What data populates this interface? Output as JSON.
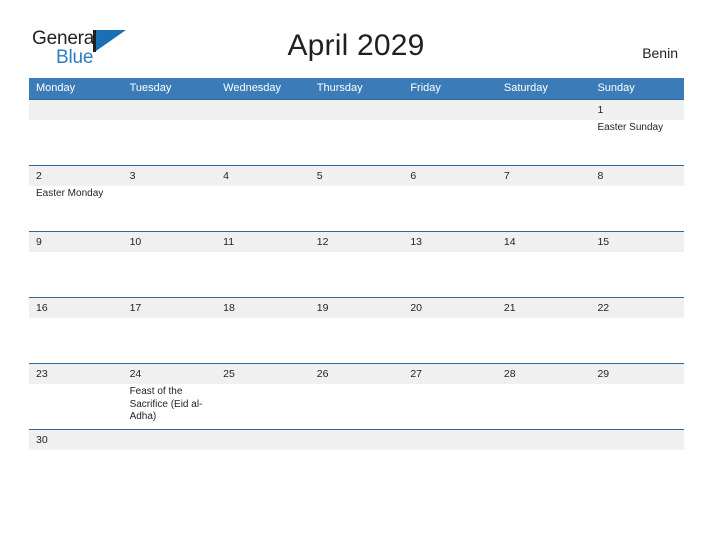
{
  "brand": {
    "word_one": "General",
    "word_two": "Blue"
  },
  "header": {
    "title": "April 2029",
    "locale": "Benin"
  },
  "calendar": {
    "weekdays": [
      "Monday",
      "Tuesday",
      "Wednesday",
      "Thursday",
      "Friday",
      "Saturday",
      "Sunday"
    ],
    "weeks": [
      [
        {
          "day": "",
          "event": ""
        },
        {
          "day": "",
          "event": ""
        },
        {
          "day": "",
          "event": ""
        },
        {
          "day": "",
          "event": ""
        },
        {
          "day": "",
          "event": ""
        },
        {
          "day": "",
          "event": ""
        },
        {
          "day": "1",
          "event": "Easter Sunday"
        }
      ],
      [
        {
          "day": "2",
          "event": "Easter Monday"
        },
        {
          "day": "3",
          "event": ""
        },
        {
          "day": "4",
          "event": ""
        },
        {
          "day": "5",
          "event": ""
        },
        {
          "day": "6",
          "event": ""
        },
        {
          "day": "7",
          "event": ""
        },
        {
          "day": "8",
          "event": ""
        }
      ],
      [
        {
          "day": "9",
          "event": ""
        },
        {
          "day": "10",
          "event": ""
        },
        {
          "day": "11",
          "event": ""
        },
        {
          "day": "12",
          "event": ""
        },
        {
          "day": "13",
          "event": ""
        },
        {
          "day": "14",
          "event": ""
        },
        {
          "day": "15",
          "event": ""
        }
      ],
      [
        {
          "day": "16",
          "event": ""
        },
        {
          "day": "17",
          "event": ""
        },
        {
          "day": "18",
          "event": ""
        },
        {
          "day": "19",
          "event": ""
        },
        {
          "day": "20",
          "event": ""
        },
        {
          "day": "21",
          "event": ""
        },
        {
          "day": "22",
          "event": ""
        }
      ],
      [
        {
          "day": "23",
          "event": ""
        },
        {
          "day": "24",
          "event": "Feast of the Sacrifice (Eid al-Adha)"
        },
        {
          "day": "25",
          "event": ""
        },
        {
          "day": "26",
          "event": ""
        },
        {
          "day": "27",
          "event": ""
        },
        {
          "day": "28",
          "event": ""
        },
        {
          "day": "29",
          "event": ""
        }
      ],
      [
        {
          "day": "30",
          "event": ""
        },
        {
          "day": "",
          "event": ""
        },
        {
          "day": "",
          "event": ""
        },
        {
          "day": "",
          "event": ""
        },
        {
          "day": "",
          "event": ""
        },
        {
          "day": "",
          "event": ""
        },
        {
          "day": "",
          "event": ""
        }
      ]
    ]
  },
  "colors": {
    "header_blue": "#3b7cb8",
    "rule_blue": "#2a6a9e",
    "band_gray": "#f0f0f0",
    "brand_blue": "#2b7dc1",
    "text": "#231f20"
  }
}
